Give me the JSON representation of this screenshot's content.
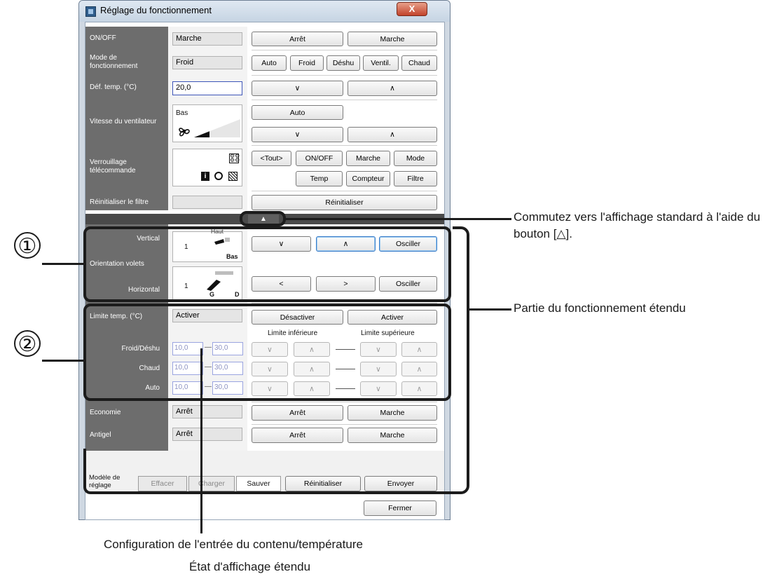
{
  "window": {
    "title": "Réglage du fonctionnement",
    "close_label": "X"
  },
  "onoff": {
    "label": "ON/OFF",
    "value": "Marche",
    "btn_off": "Arrêt",
    "btn_on": "Marche"
  },
  "mode": {
    "label": "Mode de fonctionnement",
    "value": "Froid",
    "buttons": [
      "Auto",
      "Froid",
      "Déshu",
      "Ventil.",
      "Chaud"
    ]
  },
  "temp": {
    "label": "Déf. temp. (°C)",
    "value": "20,0",
    "down": "∨",
    "up": "∧"
  },
  "fan": {
    "label": "Vitesse du ventilateur",
    "value": "Bas",
    "auto": "Auto",
    "down": "∨",
    "up": "∧"
  },
  "lock": {
    "label": "Verrouillage télécommande",
    "buttons_row1": [
      "<Tout>",
      "ON/OFF",
      "Marche",
      "Mode"
    ],
    "buttons_row2": [
      "Temp",
      "Compteur",
      "Filtre"
    ]
  },
  "filter": {
    "label": "Réinitialiser le filtre",
    "btn": "Réinitialiser"
  },
  "toggle_arrow": "▲",
  "louver": {
    "label": "Orientation volets",
    "vertical": {
      "label": "Vertical",
      "value": "1",
      "top": "Haut",
      "bottom": "Bas",
      "down": "∨",
      "up": "∧",
      "swing": "Osciller"
    },
    "horizontal": {
      "label": "Horizontal",
      "value": "1",
      "left": "G",
      "right": "D",
      "left_btn": "<",
      "right_btn": ">",
      "swing": "Osciller"
    }
  },
  "templimit": {
    "label": "Limite temp. (°C)",
    "value": "Activer",
    "disable": "Désactiver",
    "enable": "Activer",
    "lower": "Limite inférieure",
    "upper": "Limite supérieure",
    "rows": [
      {
        "label": "Froid/Déshu",
        "min": "10,0",
        "max": "30,0"
      },
      {
        "label": "Chaud",
        "min": "10,0",
        "max": "30,0"
      },
      {
        "label": "Auto",
        "min": "10,0",
        "max": "30,0"
      }
    ],
    "dash": "—",
    "down": "∨",
    "up": "∧"
  },
  "economy": {
    "label": "Economie",
    "value": "Arrêt",
    "btn_off": "Arrêt",
    "btn_on": "Marche"
  },
  "antifreeze": {
    "label": "Antigel",
    "value": "Arrêt",
    "btn_off": "Arrêt",
    "btn_on": "Marche"
  },
  "bottom": {
    "model_label": "Modèle de réglage",
    "tabs": [
      "Effacer",
      "Charger",
      "Sauver"
    ],
    "reset": "Réinitialiser",
    "send": "Envoyer",
    "close": "Fermer"
  },
  "annotations": {
    "num1": "①",
    "num2": "②",
    "note_toggle": "Commutez vers l'affichage standard à l'aide du bouton [△].",
    "note_extended": "Partie du fonctionnement étendu",
    "note_config": "Configuration de l'entrée du contenu/température",
    "note_state": "État d'affichage étendu"
  }
}
